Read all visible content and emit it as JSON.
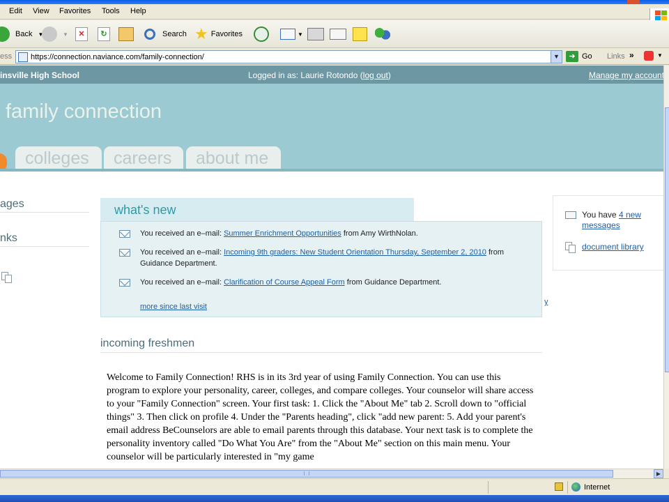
{
  "menu": [
    "Edit",
    "View",
    "Favorites",
    "Tools",
    "Help"
  ],
  "toolbar": {
    "back": "Back",
    "search": "Search",
    "favorites": "Favorites"
  },
  "address": {
    "label": "ess",
    "url": "https://connection.naviance.com/family-connection/",
    "go": "Go",
    "links": "Links",
    "chevron": "»"
  },
  "site": {
    "school": "insville High School",
    "logged_prefix": "Logged in as: Laurie Rotondo (",
    "logout": "log out",
    "logged_suffix": ")",
    "manage": "Manage my account",
    "brand": "family connection",
    "tabs": [
      "colleges",
      "careers",
      "about me"
    ]
  },
  "left": {
    "h1": "ages",
    "h2": "nks"
  },
  "whats_new": {
    "title": "what's new",
    "items": [
      {
        "prefix": "You received an e–mail: ",
        "link": "Summer Enrichment Opportunities",
        "suffix": " from Amy WirthNolan."
      },
      {
        "prefix": "You received an e–mail: ",
        "link": "Incoming 9th graders: New Student Orientation Thursday, September 2, 2010",
        "suffix": " from Guidance Department."
      },
      {
        "prefix": "You received an e–mail: ",
        "link": "Clarification of Course Appeal Form",
        "suffix": " from Guidance Department."
      }
    ],
    "more": "more since last visit",
    "stray": "y"
  },
  "right": {
    "prefix": "You have ",
    "link": "4 new messages",
    "docs": "document library"
  },
  "freshmen": {
    "title": "incoming freshmen",
    "body": "Welcome to Family Connection! RHS is in its 3rd year of using Family Connection. You can use this program to explore your personality, career, colleges, and compare colleges. Your counselor will share access to your \"Family Connection\" screen. Your first task: 1. Click the \"About Me\" tab 2. Scroll down to \"official things\" 3. Then click on profile 4. Under the \"Parents heading\", click \"add new parent: 5. Add your parent's email address BeCounselors are able to email parents through this database. Your next task is to complete the personality inventory called \"Do What You Are\" from the \"About Me\" section on this main menu. Your counselor will be particularly interested in \"my game"
  },
  "status": {
    "zone": "Internet"
  }
}
